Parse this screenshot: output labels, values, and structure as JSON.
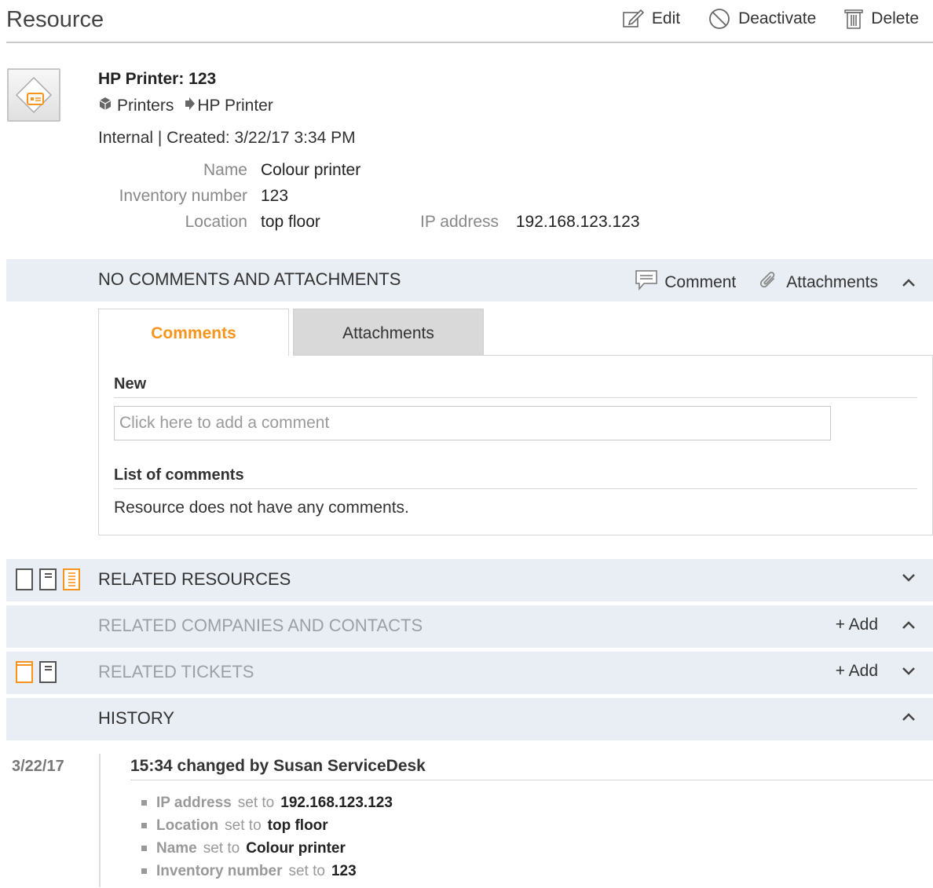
{
  "header": {
    "title": "Resource",
    "actions": {
      "edit": "Edit",
      "deactivate": "Deactivate",
      "delete": "Delete"
    }
  },
  "resource": {
    "name": "HP Printer: 123",
    "category": "Printers",
    "type": "HP Printer",
    "meta": "Internal | Created: 3/22/17 3:34 PM",
    "fields": {
      "name_label": "Name",
      "name_value": "Colour printer",
      "inventory_label": "Inventory number",
      "inventory_value": "123",
      "location_label": "Location",
      "location_value": "top floor",
      "ip_label": "IP address",
      "ip_value": "192.168.123.123"
    }
  },
  "comments_section": {
    "title": "NO COMMENTS AND ATTACHMENTS",
    "comment_action": "Comment",
    "attachments_action": "Attachments",
    "tabs": {
      "comments": "Comments",
      "attachments": "Attachments"
    },
    "new_heading": "New",
    "input_placeholder": "Click here to add a comment",
    "list_heading": "List of comments",
    "empty_text": "Resource does not have any comments."
  },
  "sections": {
    "related_resources": "RELATED RESOURCES",
    "related_companies": "RELATED COMPANIES AND CONTACTS",
    "related_tickets": "RELATED TICKETS",
    "history": "HISTORY",
    "add_label": "+ Add"
  },
  "history": {
    "date": "3/22/17",
    "heading": "15:34 changed by Susan ServiceDesk",
    "set_to": "set to",
    "entries": [
      {
        "field": "IP address",
        "value": "192.168.123.123"
      },
      {
        "field": "Location",
        "value": "top floor"
      },
      {
        "field": "Name",
        "value": "Colour printer"
      },
      {
        "field": "Inventory number",
        "value": "123"
      }
    ]
  },
  "colors": {
    "accent": "#f7941d",
    "bar_bg": "#e9eef5"
  }
}
